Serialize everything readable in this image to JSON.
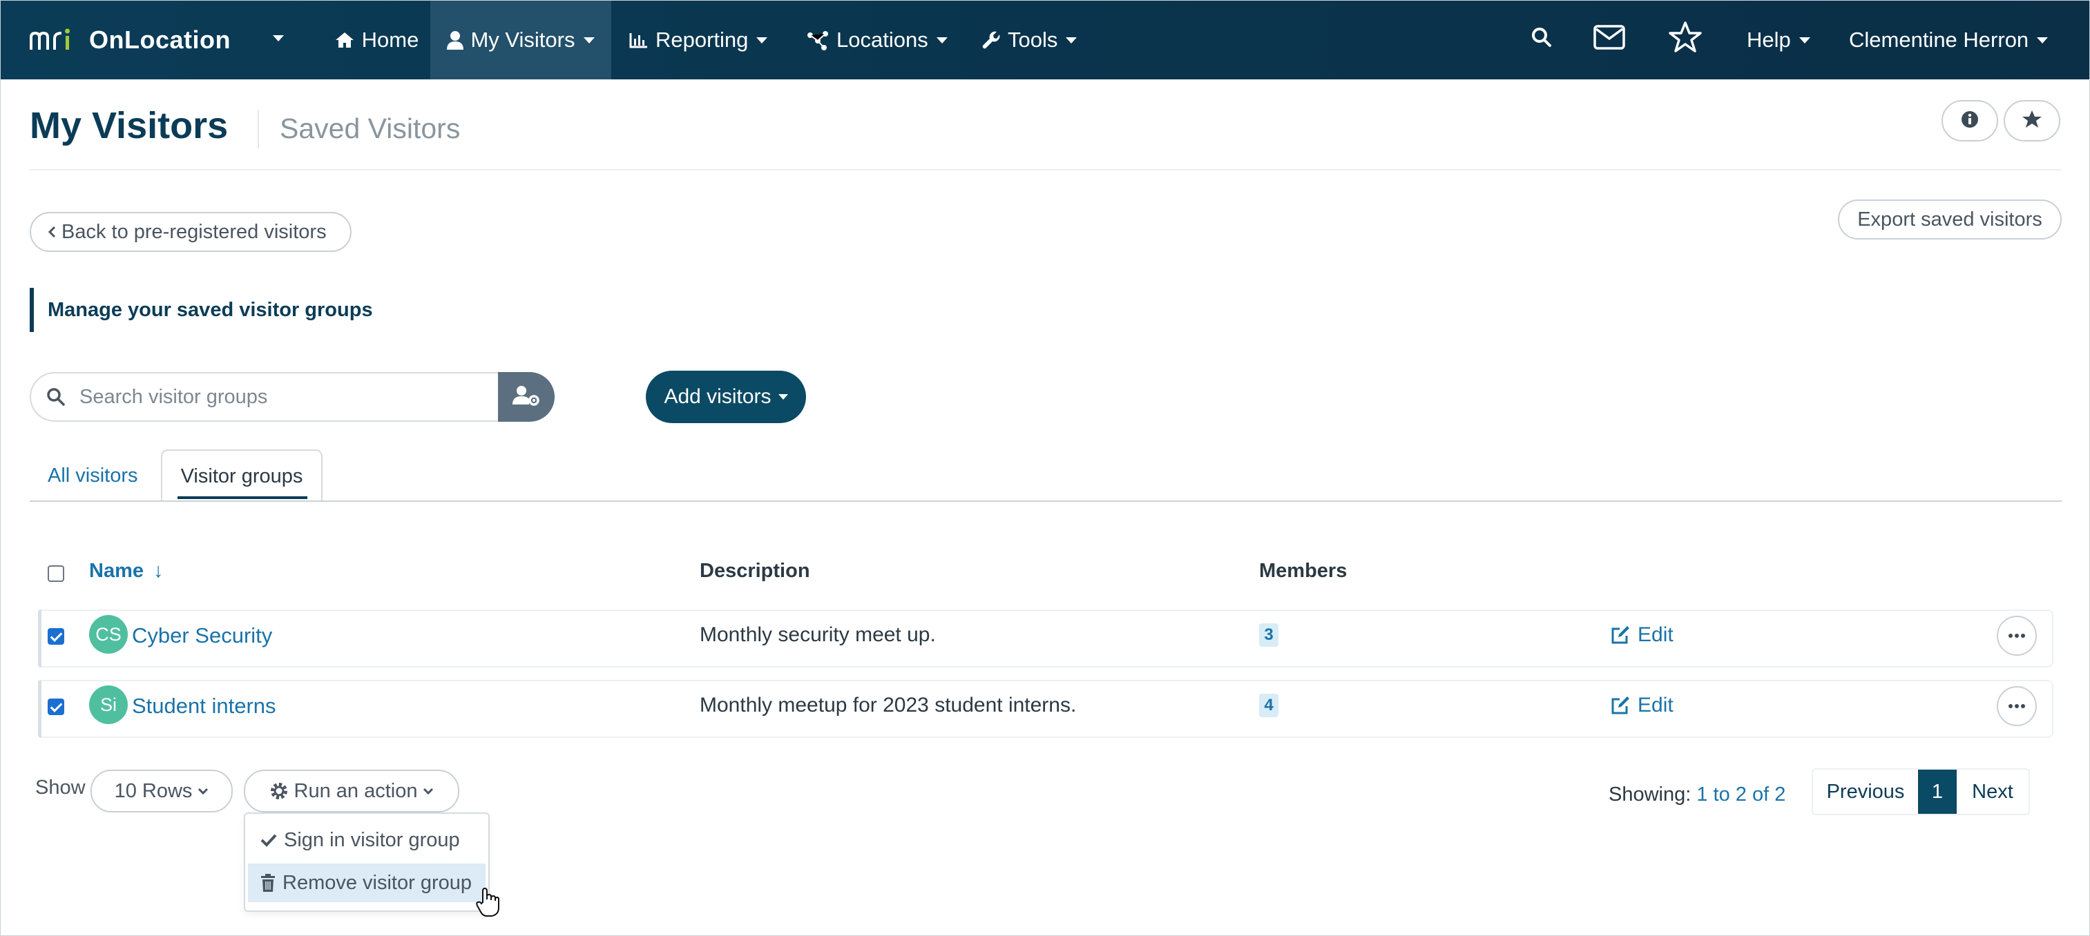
{
  "app": {
    "brand_name": "OnLocation",
    "logo_text": "mri"
  },
  "nav": {
    "items": [
      {
        "label": "Home",
        "icon": "home-icon"
      },
      {
        "label": "My Visitors",
        "icon": "user-icon",
        "active": true
      },
      {
        "label": "Reporting",
        "icon": "chart-icon"
      },
      {
        "label": "Locations",
        "icon": "network-icon"
      },
      {
        "label": "Tools",
        "icon": "wrench-icon"
      }
    ],
    "help_label": "Help",
    "user_name": "Clementine Herron"
  },
  "header": {
    "title": "My Visitors",
    "subtitle": "Saved Visitors"
  },
  "actions": {
    "back_label": "Back to pre-registered visitors",
    "export_label": "Export saved visitors",
    "callout": "Manage your saved visitor groups",
    "search_placeholder": "Search visitor groups",
    "add_label": "Add visitors"
  },
  "tabs": [
    {
      "label": "All visitors",
      "active": false
    },
    {
      "label": "Visitor groups",
      "active": true
    }
  ],
  "table": {
    "columns": {
      "name": "Name",
      "description": "Description",
      "members": "Members"
    },
    "sort_indicator": "↓",
    "edit_label": "Edit",
    "rows": [
      {
        "initials": "CS",
        "name": "Cyber Security",
        "description": "Monthly security meet up.",
        "members": "3",
        "checked": true
      },
      {
        "initials": "Si",
        "name": "Student interns",
        "description": "Monthly meetup for 2023 student interns.",
        "members": "4",
        "checked": true
      }
    ]
  },
  "footer": {
    "show_label": "Show",
    "rows_select": "10 Rows",
    "run_action_label": "Run an action",
    "menu": [
      {
        "label": "Sign in visitor group",
        "icon": "check-icon"
      },
      {
        "label": "Remove visitor group",
        "icon": "trash-icon",
        "hovered": true
      }
    ],
    "showing_prefix": "Showing:",
    "showing_range": "1 to 2 of 2",
    "pagination": {
      "previous": "Previous",
      "current": "1",
      "next": "Next"
    }
  },
  "colors": {
    "nav_bg": "#0b3c57",
    "accent": "#0b4a64",
    "link": "#1a73a8",
    "avatar": "#4fbf9f",
    "hover": "#dcebf5"
  }
}
